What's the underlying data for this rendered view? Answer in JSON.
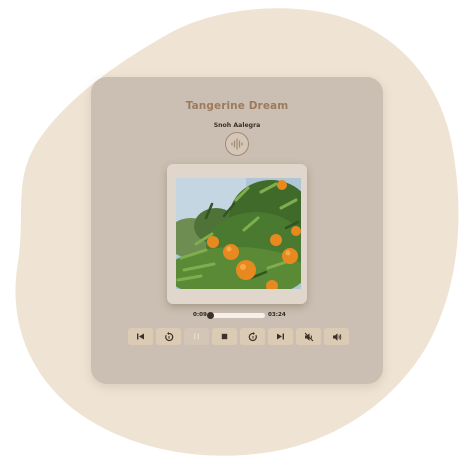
{
  "player": {
    "title": "Tangerine Dream",
    "artist": "Snoh Aalegra",
    "current_time": "0:09",
    "total_time": "03:24",
    "progress": 0.046
  },
  "controls": [
    {
      "name": "skip-back-button",
      "icon": "skip-back-icon"
    },
    {
      "name": "rewind-button",
      "icon": "rewind-icon"
    },
    {
      "name": "pause-button",
      "icon": "pause-icon",
      "disabled": true
    },
    {
      "name": "stop-button",
      "icon": "stop-icon"
    },
    {
      "name": "fast-forward-button",
      "icon": "fast-forward-icon"
    },
    {
      "name": "skip-forward-button",
      "icon": "skip-forward-icon"
    },
    {
      "name": "mute-button",
      "icon": "volume-mute-icon"
    },
    {
      "name": "volume-button",
      "icon": "volume-icon"
    }
  ],
  "colors": {
    "background_blob": "#efe3d3",
    "card": "#cabfb2",
    "title": "#9c7a5c",
    "button": "#dccbb4",
    "icon": "#3b3128"
  }
}
